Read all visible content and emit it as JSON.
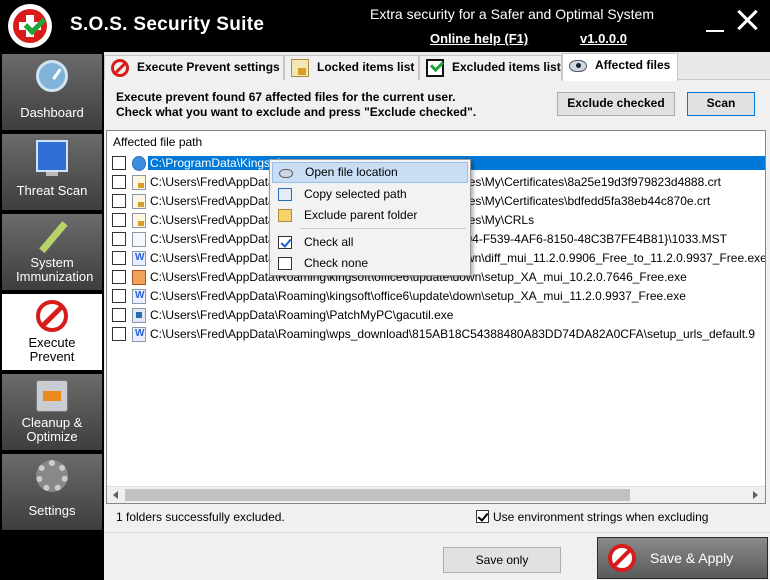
{
  "app": {
    "title": "S.O.S. Security Suite",
    "tagline": "Extra security for a Safer and Optimal System",
    "help_link": "Online help (F1)",
    "version": "v1.0.0.0"
  },
  "sidebar": {
    "items": [
      {
        "label": "Dashboard",
        "icon": "dashboard-icon"
      },
      {
        "label": "Threat Scan",
        "icon": "monitor-icon"
      },
      {
        "label": "System Immunization",
        "icon": "syringe-icon"
      },
      {
        "label": "Execute Prevent",
        "icon": "no-entry-icon",
        "active": true
      },
      {
        "label": "Cleanup & Optimize",
        "icon": "toolbox-icon"
      },
      {
        "label": "Settings",
        "icon": "gear-icon"
      }
    ]
  },
  "tabs": [
    {
      "label": "Execute Prevent settings",
      "icon": "no-entry-icon"
    },
    {
      "label": "Locked items list",
      "icon": "lock-icon"
    },
    {
      "label": "Excluded items list",
      "icon": "checkbox-icon"
    },
    {
      "label": "Affected files",
      "icon": "eye-icon",
      "active": true
    }
  ],
  "main": {
    "info_line1": "Execute prevent found 67 affected files for the current user.",
    "info_line2": "Check what you want to exclude and press \"Exclude checked\".",
    "exclude_button": "Exclude checked",
    "scan_button": "Scan",
    "list_header": "Affected file path",
    "rows": [
      {
        "path": "C:\\ProgramData\\Kingsoft",
        "icon": "folder-icon",
        "checked": false,
        "selected": true
      },
      {
        "path": "C:\\Users\\Fred\\AppData\\Roaming\\Microsoft\\SystemCertificates\\My\\Certificates\\8a25e19d3f979823d4888.crt",
        "icon": "certificate-icon",
        "checked": false
      },
      {
        "path": "C:\\Users\\Fred\\AppData\\Roaming\\Microsoft\\SystemCertificates\\My\\Certificates\\bdfedd5fa38eb44c870e.crt",
        "icon": "certificate-icon",
        "checked": false
      },
      {
        "path": "C:\\Users\\Fred\\AppData\\Roaming\\Microsoft\\SystemCertificates\\My\\CRLs",
        "icon": "certificate-icon",
        "checked": false
      },
      {
        "path": "C:\\Users\\Fred\\AppData\\Roaming\\Microsoft\\Installer\\{2B64294-F539-4AF6-8150-48C3B7FE4B81}\\1033.MST",
        "icon": "file-icon",
        "checked": false
      },
      {
        "path": "C:\\Users\\Fred\\AppData\\Roaming\\kingsoft\\office6\\update\\down\\diff_mui_11.2.0.9906_Free_to_11.2.0.9937_Free.exe",
        "icon": "wps-icon",
        "checked": false
      },
      {
        "path": "C:\\Users\\Fred\\AppData\\Roaming\\kingsoft\\office6\\update\\down\\setup_XA_mui_10.2.0.7646_Free.exe",
        "icon": "installer-icon",
        "checked": false
      },
      {
        "path": "C:\\Users\\Fred\\AppData\\Roaming\\kingsoft\\office6\\update\\down\\setup_XA_mui_11.2.0.9937_Free.exe",
        "icon": "wps-icon",
        "checked": false
      },
      {
        "path": "C:\\Users\\Fred\\AppData\\Roaming\\PatchMyPC\\gacutil.exe",
        "icon": "exe-icon",
        "checked": false
      },
      {
        "path": "C:\\Users\\Fred\\AppData\\Roaming\\wps_download\\815AB18C54388480A83DD74DA82A0CFA\\setup_urls_default.9",
        "icon": "wps-icon",
        "checked": false
      }
    ],
    "status_text": "1 folders successfully excluded.",
    "env_strings_label": "Use environment strings when excluding",
    "env_strings_checked": true,
    "save_only_button": "Save only",
    "save_apply_button": "Save & Apply"
  },
  "context_menu": {
    "items": [
      {
        "label": "Open file location",
        "icon": "eye-icon",
        "highlighted": true
      },
      {
        "label": "Copy selected path",
        "icon": "copy-icon"
      },
      {
        "label": "Exclude parent folder",
        "icon": "folder-icon"
      },
      {
        "label": "Check all",
        "icon": "checked-box-icon"
      },
      {
        "label": "Check none",
        "icon": "unchecked-box-icon"
      }
    ]
  },
  "colors": {
    "accent_red": "#d81b1b",
    "selection_blue": "#0078d7",
    "menu_highlight": "#c9def5"
  }
}
